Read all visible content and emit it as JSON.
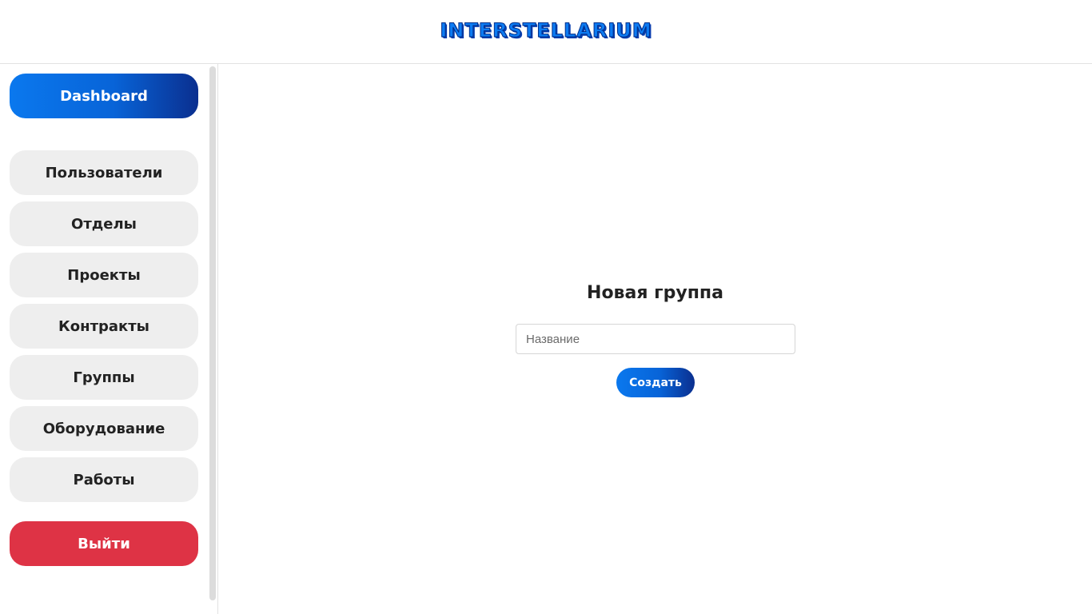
{
  "header": {
    "logo_text": "INTERSTELLARIUM"
  },
  "sidebar": {
    "dashboard_label": "Dashboard",
    "items": [
      {
        "label": "Пользователи"
      },
      {
        "label": "Отделы"
      },
      {
        "label": "Проекты"
      },
      {
        "label": "Контракты"
      },
      {
        "label": "Группы"
      },
      {
        "label": "Оборудование"
      },
      {
        "label": "Работы"
      }
    ],
    "logout_label": "Выйти"
  },
  "form": {
    "title": "Новая группа",
    "name_placeholder": "Название",
    "name_value": "",
    "submit_label": "Создать"
  },
  "colors": {
    "primary_gradient_start": "#0a78ee",
    "primary_gradient_end": "#0a2f8f",
    "danger": "#de3345",
    "nav_item_bg": "#eeeeee"
  }
}
